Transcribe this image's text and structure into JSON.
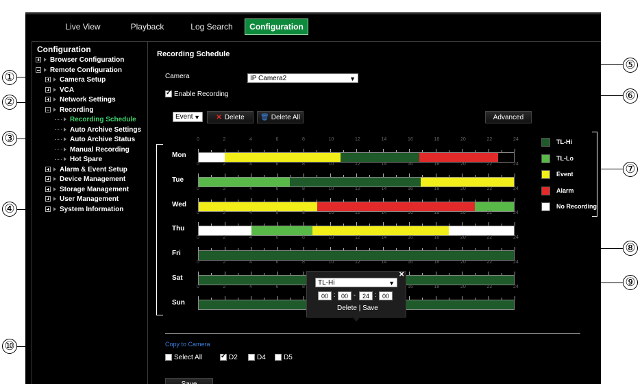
{
  "nav": {
    "tabs": [
      {
        "label": "Live View"
      },
      {
        "label": "Playback"
      },
      {
        "label": "Log Search"
      },
      {
        "label": "Configuration"
      }
    ],
    "active_tab": "Configuration",
    "accent_color": "#0e8a3c"
  },
  "sidebar": {
    "title": "Configuration",
    "items": [
      {
        "label": "Browser Configuration",
        "icon": "plus-icon"
      },
      {
        "label": "Remote Configuration",
        "icon": "minus-icon"
      },
      {
        "label": "Camera Setup",
        "icon": "plus-icon"
      },
      {
        "label": "VCA",
        "icon": "plus-icon"
      },
      {
        "label": "Network Settings",
        "icon": "plus-icon"
      },
      {
        "label": "Recording",
        "icon": "minus-icon"
      },
      {
        "label": "Recording Schedule",
        "icon": "arrow-icon"
      },
      {
        "label": "Auto Archive Settings",
        "icon": "arrow-icon"
      },
      {
        "label": "Auto Archive Status",
        "icon": "arrow-icon"
      },
      {
        "label": "Manual Recording",
        "icon": "arrow-icon"
      },
      {
        "label": "Hot Spare",
        "icon": "arrow-icon"
      },
      {
        "label": "Alarm & Event Setup",
        "icon": "plus-icon"
      },
      {
        "label": "Device Management",
        "icon": "plus-icon"
      },
      {
        "label": "Storage Management",
        "icon": "plus-icon"
      },
      {
        "label": "User Management",
        "icon": "plus-icon"
      },
      {
        "label": "System Information",
        "icon": "plus-icon"
      }
    ]
  },
  "main": {
    "title": "Recording Schedule",
    "camera_label": "Camera",
    "camera_value": "IP Camera2",
    "enable_recording_label": "Enable Recording",
    "enable_recording_checked": true,
    "type_select_value": "Event",
    "delete_label": "Delete",
    "delete_all_label": "Delete All",
    "advanced_label": "Advanced",
    "hours": [
      "0",
      "2",
      "4",
      "6",
      "8",
      "10",
      "12",
      "14",
      "16",
      "18",
      "20",
      "22",
      "24"
    ]
  },
  "schedule": [
    {
      "day": "Mon",
      "segments": [
        {
          "start": 0,
          "end": 3.3,
          "type": "No Recording"
        },
        {
          "start": 3.3,
          "end": 18,
          "type": "Event"
        },
        {
          "start": 18,
          "end": 28,
          "type": "TL-Hi"
        },
        {
          "start": 28,
          "end": 38,
          "type": "Alarm"
        }
      ]
    },
    {
      "day": "Tue",
      "segments": [
        {
          "start": 0,
          "end": 11.6,
          "type": "TL-Lo"
        },
        {
          "start": 11.6,
          "end": 28.2,
          "type": "TL-Hi"
        },
        {
          "start": 28.2,
          "end": 40,
          "type": "Event"
        }
      ]
    },
    {
      "day": "Wed",
      "segments": [
        {
          "start": 0,
          "end": 15,
          "type": "Event"
        },
        {
          "start": 15,
          "end": 35,
          "type": "Alarm"
        },
        {
          "start": 35,
          "end": 40,
          "type": "TL-Lo"
        }
      ]
    },
    {
      "day": "Thu",
      "segments": [
        {
          "start": 0,
          "end": 6.7,
          "type": "No Recording"
        },
        {
          "start": 6.7,
          "end": 14.4,
          "type": "TL-Lo"
        },
        {
          "start": 14.4,
          "end": 31.7,
          "type": "Event"
        },
        {
          "start": 31.7,
          "end": 40,
          "type": "No Recording"
        }
      ]
    },
    {
      "day": "Fri",
      "segments": [
        {
          "start": 0,
          "end": 40,
          "type": "TL-Hi"
        }
      ]
    },
    {
      "day": "Sat",
      "segments": [
        {
          "start": 0,
          "end": 40,
          "type": "TL-Hi"
        }
      ]
    },
    {
      "day": "Sun",
      "segments": [
        {
          "start": 0,
          "end": 40,
          "type": "TL-Hi"
        }
      ]
    }
  ],
  "legend": [
    {
      "label": "TL-Hi",
      "color": "#1f5a2a"
    },
    {
      "label": "TL-Lo",
      "color": "#59b948"
    },
    {
      "label": "Event",
      "color": "#f2ee1a"
    },
    {
      "label": "Alarm",
      "color": "#e22a2a"
    },
    {
      "label": "No Recording",
      "color": "#ffffff"
    }
  ],
  "popup": {
    "type_value": "TL-Hi",
    "close_glyph": "×",
    "start_hour": "00",
    "start_min": "00",
    "end_hour": "24",
    "end_min": "00",
    "delete_label": "Delete",
    "separator": "|",
    "save_label": "Save"
  },
  "copy": {
    "title": "Copy to Camera",
    "select_all_label": "Select All",
    "cameras": [
      {
        "label": "D2",
        "checked": true
      },
      {
        "label": "D4",
        "checked": false
      },
      {
        "label": "D5",
        "checked": false
      }
    ],
    "save_label": "Save"
  },
  "callouts": [
    "①",
    "②",
    "③",
    "④",
    "⑤",
    "⑥",
    "⑦",
    "⑧",
    "⑨",
    "⑩"
  ]
}
